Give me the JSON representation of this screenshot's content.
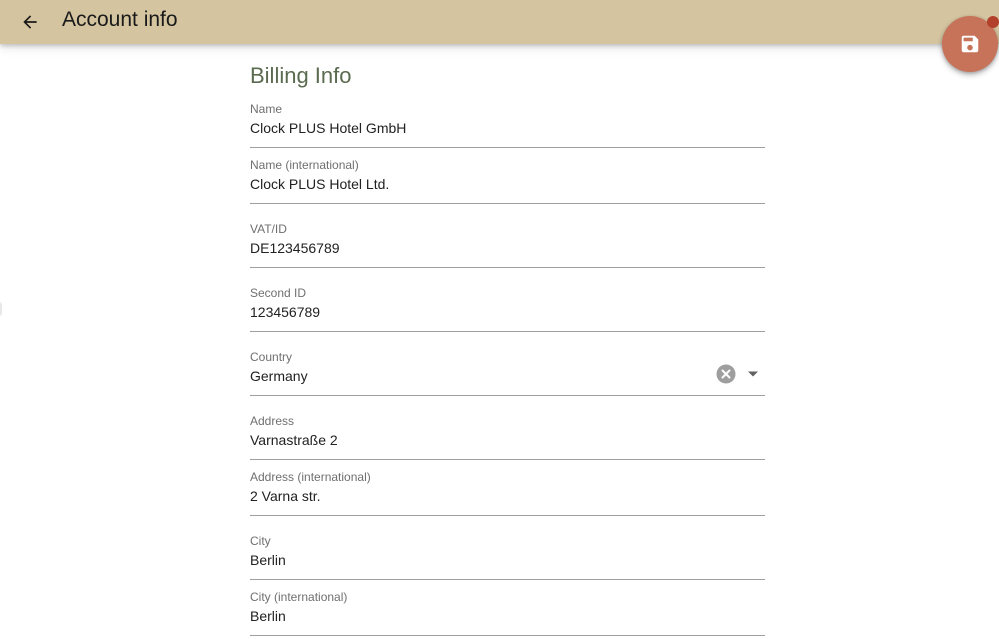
{
  "header": {
    "title": "Account info",
    "back_icon": "arrow-left-icon",
    "save_icon": "floppy-disk-icon",
    "colors": {
      "app_bar": "#d4c4a0",
      "fab": "#c7735a",
      "fab_badge": "#b2402a",
      "section_title": "#5b6b4f"
    }
  },
  "billing": {
    "section_title": "Billing Info",
    "fields": [
      {
        "label": "Name",
        "value": "Clock PLUS Hotel GmbH"
      },
      {
        "label": "Name (international)",
        "value": "Clock PLUS Hotel Ltd."
      },
      {
        "label": "VAT/ID",
        "value": "DE123456789"
      },
      {
        "label": "Second ID",
        "value": "123456789"
      },
      {
        "label": "Country",
        "value": "Germany",
        "type": "select",
        "icons": [
          "clear-icon",
          "chevron-down-icon"
        ]
      },
      {
        "label": "Address",
        "value": "Varnastraße 2"
      },
      {
        "label": "Address (international)",
        "value": "2 Varna str."
      },
      {
        "label": "City",
        "value": "Berlin"
      },
      {
        "label": "City (international)",
        "value": "Berlin"
      }
    ]
  }
}
